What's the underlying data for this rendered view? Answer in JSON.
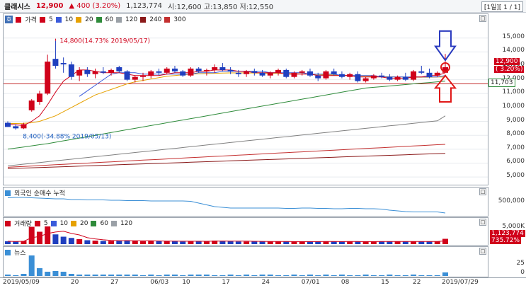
{
  "header": {
    "name": "클래시스",
    "price": "12,900",
    "change": "▲ 400 (3.20%)",
    "volume": "1,123,774",
    "ohl": "시:12,600  고:13,850  저:12,550",
    "period": "[1일][ 1 / 1]"
  },
  "price_panel": {
    "legend": [
      "가격",
      "5",
      "10",
      "20",
      "60",
      "120",
      "240",
      "300"
    ],
    "legend_colors": [
      "#d0021b",
      "#d0021b",
      "#3b5bdb",
      "#e6a100",
      "#2e8b3a",
      "#9aa0a6",
      "#8b1a1a",
      "#c43030"
    ],
    "tag": "호",
    "annotation_high": "14,800(14.73% 2019/05/17)",
    "annotation_low": "8,400(-34.88% 2019/05/13)",
    "y_ticks": [
      "15,000",
      "14,000",
      "13,000",
      "12,000",
      "11,000",
      "10,000",
      "9,000",
      "8,000",
      "7,000",
      "6,000",
      "5,000"
    ],
    "current_price_label": "12,900",
    "current_change_label": "3.20%",
    "hline_label": "11,703"
  },
  "foreign_panel": {
    "title": "외국인 순매수 누적",
    "y_ticks": [
      "500,000"
    ]
  },
  "volume_panel": {
    "legend": [
      "거래량",
      "5",
      "10",
      "20",
      "60",
      "120"
    ],
    "y_ticks": [
      "5,000K"
    ],
    "current_volume_label": "1,123,774",
    "current_pct_label": "735.72%"
  },
  "news_panel": {
    "title": "뉴스",
    "y_ticks": [
      "25",
      "0"
    ]
  },
  "x_axis": [
    "2019/05/09",
    "20",
    "27",
    "06/03",
    "10",
    "17",
    "24",
    "07/01",
    "08",
    "15",
    "22",
    "2019/07/29"
  ],
  "colors": {
    "up": "#d0021b",
    "down": "#1f3fbf",
    "ma5": "#d0021b",
    "ma10": "#3b5bdb",
    "ma20": "#e6a100",
    "ma60": "#2e8b3a",
    "ma120": "#808080",
    "ma240": "#8b1a1a"
  },
  "chart_data": {
    "type": "candlestick",
    "period": "daily",
    "ylim": [
      4700,
      15800
    ],
    "candles": [
      [
        8900,
        9000,
        8600,
        8600
      ],
      [
        8650,
        8800,
        8400,
        8500
      ],
      [
        8500,
        8900,
        8450,
        8800
      ],
      [
        9800,
        10600,
        9700,
        10500
      ],
      [
        10400,
        11200,
        10200,
        11000
      ],
      [
        11000,
        13800,
        10900,
        13300
      ],
      [
        13500,
        14800,
        12800,
        13000
      ],
      [
        13200,
        13600,
        12500,
        13100
      ],
      [
        13100,
        13300,
        12000,
        12200
      ],
      [
        12300,
        12900,
        11900,
        12700
      ],
      [
        12700,
        12900,
        12200,
        12400
      ],
      [
        12400,
        12800,
        12100,
        12600
      ],
      [
        12600,
        12900,
        12400,
        12500
      ],
      [
        12500,
        12800,
        12300,
        12700
      ],
      [
        12900,
        13000,
        12500,
        12600
      ],
      [
        12600,
        12700,
        11900,
        12000
      ],
      [
        12000,
        12300,
        11800,
        12200
      ],
      [
        12200,
        12500,
        11900,
        12300
      ],
      [
        12300,
        12700,
        12100,
        12600
      ],
      [
        12600,
        12800,
        12300,
        12500
      ],
      [
        12500,
        12900,
        12400,
        12800
      ],
      [
        12800,
        13000,
        12500,
        12600
      ],
      [
        12600,
        12700,
        12200,
        12300
      ],
      [
        12300,
        12900,
        12200,
        12800
      ],
      [
        12800,
        12900,
        12500,
        12600
      ],
      [
        12600,
        12800,
        12300,
        12700
      ],
      [
        12700,
        13100,
        12500,
        12900
      ],
      [
        12900,
        13200,
        12600,
        12700
      ],
      [
        12700,
        12900,
        12400,
        12600
      ],
      [
        12500,
        12700,
        12200,
        12400
      ],
      [
        12400,
        12700,
        12200,
        12600
      ],
      [
        12600,
        12800,
        12300,
        12500
      ],
      [
        12500,
        12700,
        12200,
        12300
      ],
      [
        12300,
        12600,
        12100,
        12500
      ],
      [
        12500,
        12800,
        12300,
        12700
      ],
      [
        12700,
        12800,
        12100,
        12200
      ],
      [
        12200,
        12600,
        12100,
        12500
      ],
      [
        12500,
        12700,
        12300,
        12600
      ],
      [
        12600,
        12800,
        12200,
        12300
      ],
      [
        12300,
        12500,
        11900,
        12100
      ],
      [
        12100,
        12700,
        12000,
        12600
      ],
      [
        12600,
        12800,
        12300,
        12400
      ],
      [
        12400,
        12600,
        12100,
        12200
      ],
      [
        12200,
        12500,
        12000,
        12400
      ],
      [
        12400,
        12600,
        11800,
        11900
      ],
      [
        11900,
        12200,
        11800,
        12100
      ],
      [
        12100,
        12400,
        12000,
        12300
      ],
      [
        12300,
        12500,
        12100,
        12200
      ],
      [
        12200,
        12400,
        11900,
        12000
      ],
      [
        12000,
        12300,
        11900,
        12200
      ],
      [
        12200,
        12500,
        11900,
        12000
      ],
      [
        12000,
        12700,
        11900,
        12600
      ],
      [
        12600,
        13000,
        12400,
        12500
      ],
      [
        12500,
        12800,
        12100,
        12200
      ],
      [
        12300,
        12600,
        12200,
        12500
      ],
      [
        12500,
        13850,
        12550,
        12900
      ]
    ],
    "ma5": [
      8800,
      8750,
      8700,
      9000,
      9400,
      10200,
      11100,
      11900,
      12300,
      12700,
      12700,
      12600,
      12500,
      12500,
      12500,
      12400,
      12300,
      12300,
      12300,
      12300,
      12400,
      12500,
      12500,
      12500,
      12600,
      12600,
      12700,
      12700,
      12700,
      12600,
      12600,
      12500,
      12500,
      12500,
      12500,
      12400,
      12400,
      12400,
      12400,
      12300,
      12300,
      12300,
      12300,
      12300,
      12200,
      12200,
      12200,
      12200,
      12100,
      12100,
      12100,
      12200,
      12200,
      12300,
      12300,
      12500
    ],
    "ma10": [
      null,
      null,
      null,
      null,
      null,
      null,
      null,
      null,
      null,
      10800,
      11200,
      11600,
      12000,
      12400,
      12500,
      12500,
      12500,
      12400,
      12400,
      12400,
      12400,
      12400,
      12400,
      12400,
      12500,
      12500,
      12500,
      12600,
      12600,
      12600,
      12600,
      12600,
      12600,
      12500,
      12500,
      12500,
      12500,
      12500,
      12400,
      12400,
      12400,
      12400,
      12300,
      12300,
      12300,
      12300,
      12300,
      12200,
      12200,
      12200,
      12200,
      12200,
      12200,
      12200,
      12200,
      12300
    ],
    "ma20": [
      8850,
      8850,
      8860,
      8900,
      9000,
      9200,
      9400,
      9700,
      10000,
      10300,
      10600,
      10900,
      11100,
      11300,
      11500,
      11700,
      11850,
      11950,
      12050,
      12150,
      12250,
      12300,
      12350,
      12400,
      12420,
      12440,
      12460,
      12480,
      12490,
      12490,
      12490,
      12480,
      12470,
      12460,
      12450,
      12440,
      12430,
      12420,
      12400,
      12380,
      12360,
      12340,
      12320,
      12300,
      12280,
      12260,
      12240,
      12220,
      12210,
      12200,
      12190,
      12180,
      12180,
      12180,
      12190,
      12200
    ],
    "ma60": [
      7000,
      7080,
      7160,
      7240,
      7320,
      7400,
      7500,
      7600,
      7700,
      7800,
      7900,
      8000,
      8100,
      8200,
      8300,
      8400,
      8500,
      8600,
      8700,
      8800,
      8900,
      9000,
      9100,
      9200,
      9300,
      9400,
      9500,
      9600,
      9700,
      9800,
      9900,
      10000,
      10100,
      10200,
      10300,
      10400,
      10500,
      10600,
      10700,
      10800,
      10900,
      11000,
      11100,
      11200,
      11300,
      11400,
      11450,
      11500,
      11550,
      11600,
      11650,
      11700,
      11750,
      11800,
      11850,
      11900
    ],
    "ma120": [
      5800,
      5860,
      5920,
      5980,
      6040,
      6100,
      6160,
      6220,
      6280,
      6340,
      6400,
      6460,
      6520,
      6580,
      6640,
      6700,
      6760,
      6820,
      6880,
      6940,
      7000,
      7060,
      7120,
      7180,
      7240,
      7300,
      7360,
      7420,
      7480,
      7540,
      7600,
      7660,
      7720,
      7780,
      7840,
      7900,
      7960,
      8020,
      8080,
      8140,
      8200,
      8260,
      8320,
      8380,
      8440,
      8500,
      8560,
      8620,
      8680,
      8740,
      8800,
      8860,
      8920,
      8980,
      9040,
      9400
    ],
    "ma240": [
      5600,
      5620,
      5640,
      5660,
      5680,
      5700,
      5720,
      5740,
      5760,
      5780,
      5800,
      5820,
      5840,
      5860,
      5880,
      5900,
      5920,
      5940,
      5960,
      5980,
      6000,
      6020,
      6040,
      6060,
      6080,
      6100,
      6120,
      6140,
      6160,
      6180,
      6200,
      6220,
      6240,
      6260,
      6280,
      6300,
      6320,
      6340,
      6360,
      6380,
      6400,
      6420,
      6440,
      6460,
      6480,
      6500,
      6520,
      6540,
      6560,
      6580,
      6600,
      6620,
      6640,
      6660,
      6680,
      6700
    ],
    "ma300": [
      5700,
      5730,
      5760,
      5790,
      5820,
      5850,
      5880,
      5910,
      5940,
      5970,
      6000,
      6030,
      6060,
      6090,
      6120,
      6150,
      6180,
      6210,
      6240,
      6270,
      6300,
      6330,
      6360,
      6390,
      6420,
      6450,
      6480,
      6510,
      6540,
      6570,
      6600,
      6630,
      6660,
      6690,
      6720,
      6750,
      6780,
      6810,
      6840,
      6870,
      6900,
      6930,
      6960,
      6990,
      7020,
      7050,
      7080,
      7110,
      7140,
      7170,
      7200,
      7230,
      7260,
      7290,
      7320,
      7350
    ],
    "hline": 11703,
    "foreign_cum": [
      0.95,
      0.96,
      0.96,
      0.95,
      0.94,
      0.93,
      0.92,
      0.92,
      0.9,
      0.9,
      0.89,
      0.89,
      0.89,
      0.88,
      0.88,
      0.87,
      0.87,
      0.87,
      0.86,
      0.86,
      0.86,
      0.86,
      0.86,
      0.85,
      0.8,
      0.75,
      0.7,
      0.68,
      0.66,
      0.66,
      0.66,
      0.66,
      0.66,
      0.66,
      0.66,
      0.65,
      0.65,
      0.66,
      0.66,
      0.65,
      0.65,
      0.64,
      0.64,
      0.65,
      0.65,
      0.64,
      0.64,
      0.63,
      0.6,
      0.58,
      0.56,
      0.55,
      0.55,
      0.55,
      0.55,
      0.52
    ],
    "volume_pct": [
      0.16,
      0.14,
      0.18,
      0.98,
      0.7,
      1.0,
      0.55,
      0.42,
      0.35,
      0.28,
      0.22,
      0.2,
      0.18,
      0.18,
      0.2,
      0.22,
      0.18,
      0.16,
      0.18,
      0.16,
      0.18,
      0.16,
      0.15,
      0.18,
      0.16,
      0.16,
      0.2,
      0.18,
      0.16,
      0.15,
      0.15,
      0.16,
      0.15,
      0.14,
      0.16,
      0.14,
      0.14,
      0.15,
      0.14,
      0.16,
      0.15,
      0.14,
      0.14,
      0.15,
      0.16,
      0.14,
      0.14,
      0.15,
      0.16,
      0.15,
      0.14,
      0.16,
      0.15,
      0.14,
      0.15,
      0.3
    ],
    "news": [
      2,
      1,
      3,
      29,
      11,
      6,
      7,
      6,
      3,
      2,
      2,
      2,
      2,
      2,
      2,
      2,
      2,
      1,
      2,
      1,
      2,
      2,
      1,
      2,
      2,
      2,
      1,
      1,
      2,
      1,
      2,
      1,
      2,
      2,
      1,
      1,
      2,
      1,
      2,
      1,
      2,
      1,
      2,
      1,
      1,
      2,
      1,
      1,
      2,
      1,
      1,
      2,
      1,
      1,
      1,
      5
    ]
  }
}
